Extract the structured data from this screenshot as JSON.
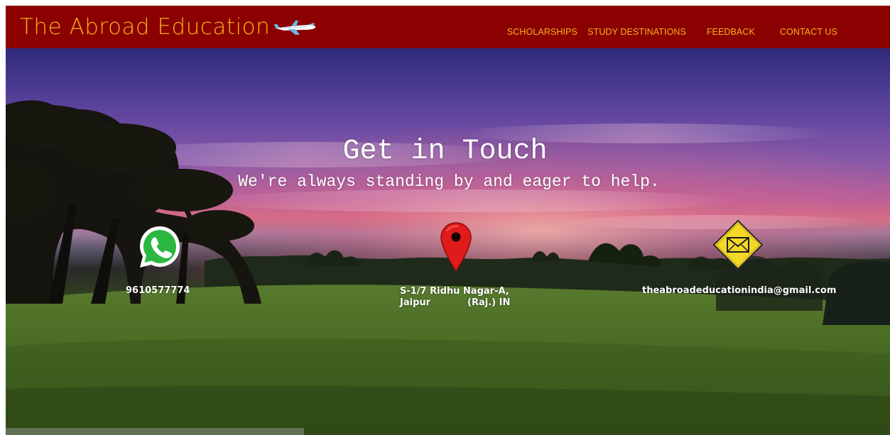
{
  "brand": {
    "logo_text": "The Abroad Education",
    "logo_icon": "airplane-icon",
    "header_color": "#8b0000",
    "accent_color": "#f2b21c"
  },
  "nav": {
    "items": [
      {
        "label": "SCHOLARSHIPS"
      },
      {
        "label": "STUDY DESTINATIONS"
      },
      {
        "label": "FEEDBACK"
      },
      {
        "label": "CONTACT US"
      }
    ]
  },
  "hero": {
    "title": "Get in Touch",
    "subtitle": "We're always standing by and eager to help."
  },
  "contacts": {
    "phone": {
      "icon": "whatsapp-icon",
      "value": "9610577774"
    },
    "address": {
      "icon": "map-pin-icon",
      "line1": "S-1/7 Ridhu Nagar-A,",
      "line2_city": "Jaipur",
      "line2_state": "(Raj.) IN"
    },
    "email": {
      "icon": "envelope-icon",
      "value": "theabroadeducationindia@gmail.com"
    }
  }
}
